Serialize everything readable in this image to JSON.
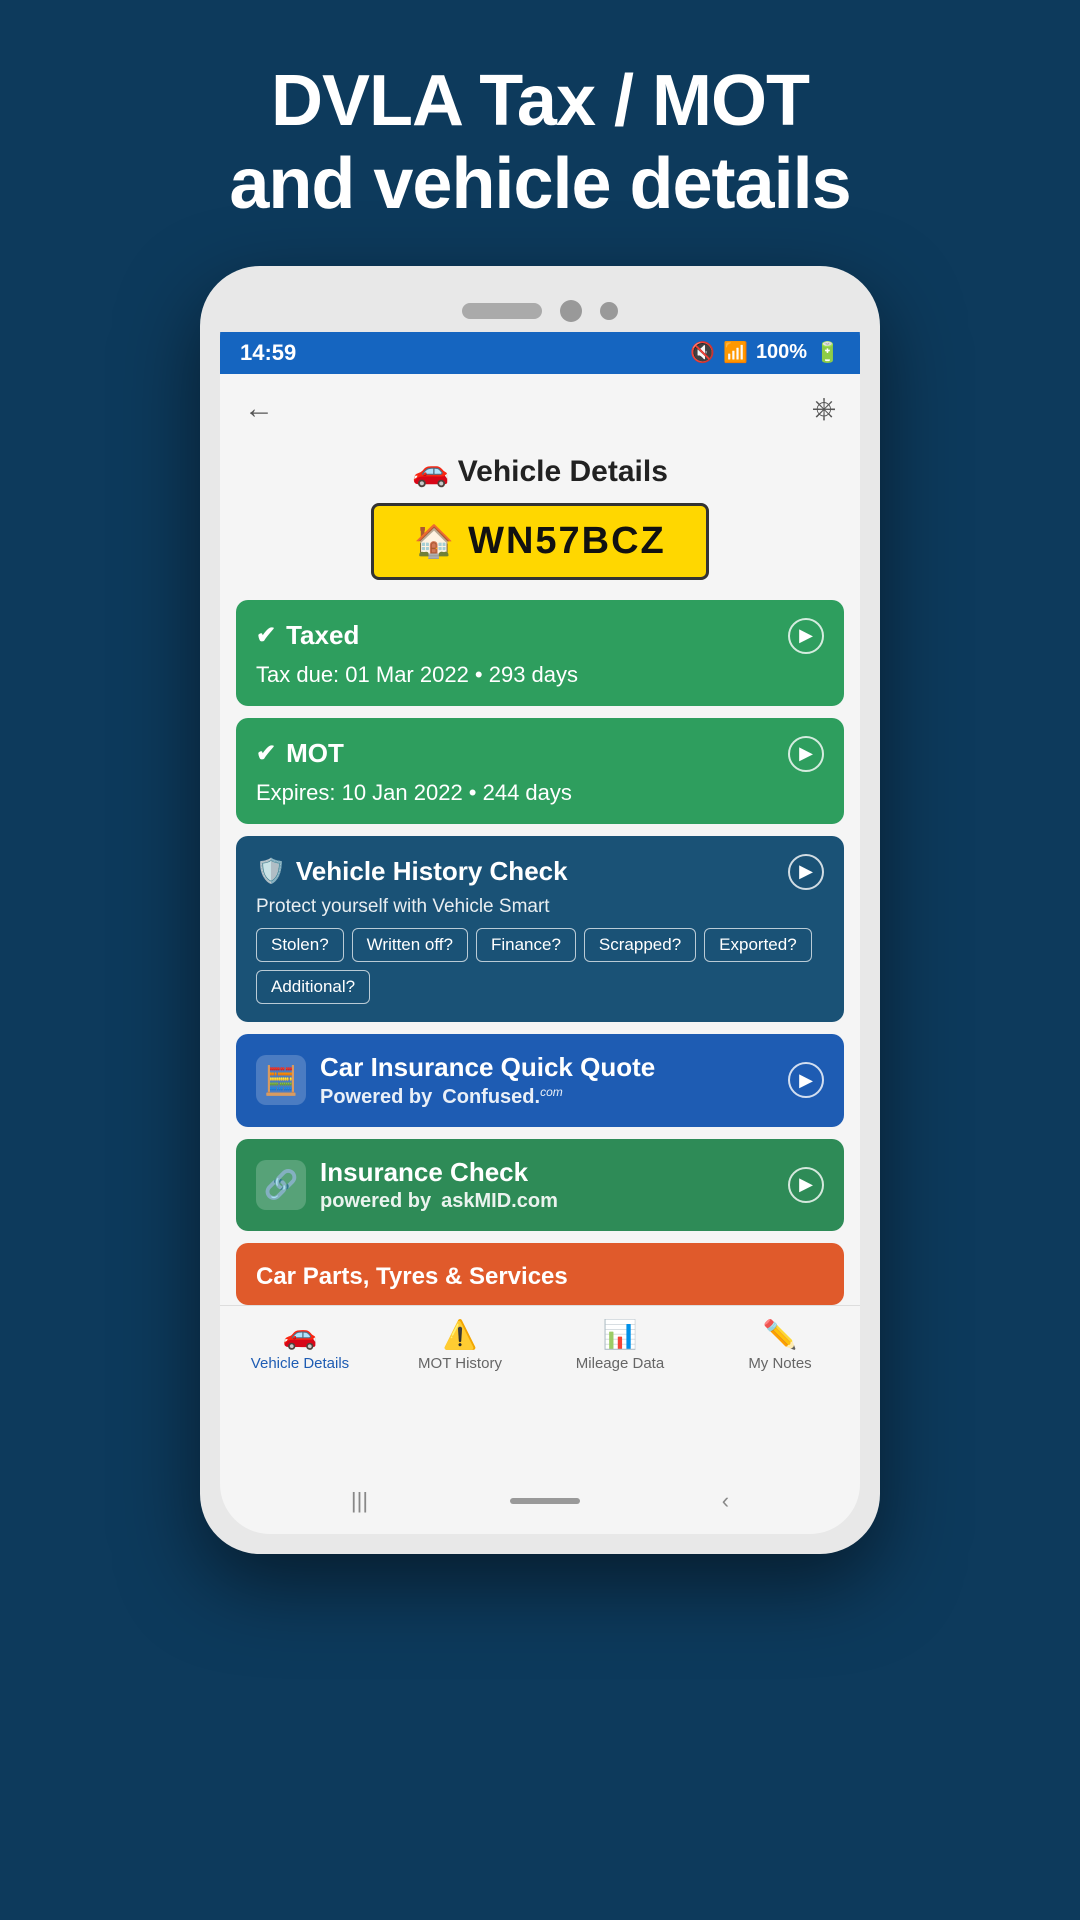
{
  "page": {
    "header_line1": "DVLA Tax / MOT",
    "header_line2": "and vehicle details"
  },
  "status_bar": {
    "time": "14:59",
    "battery": "100%"
  },
  "app": {
    "title": "🚗 Vehicle Details",
    "plate": "WN57BCZ",
    "plate_icon": "🏠"
  },
  "cards": {
    "taxed": {
      "label": "Taxed",
      "detail": "Tax due: 01 Mar 2022 • 293 days"
    },
    "mot": {
      "label": "MOT",
      "detail": "Expires: 10 Jan 2022 • 244 days"
    },
    "history": {
      "title": "Vehicle History Check",
      "subtitle": "Protect yourself with Vehicle Smart",
      "tags": [
        "Stolen?",
        "Written off?",
        "Finance?",
        "Scrapped?",
        "Exported?",
        "Additional?"
      ]
    },
    "insurance_quote": {
      "title": "Car Insurance Quick Quote",
      "powered_by": "Powered by",
      "brand": "Confused."
    },
    "insurance_check": {
      "title": "Insurance Check",
      "powered_by": "powered by",
      "brand": "askMID.com"
    },
    "parts": {
      "title": "Car Parts, Tyres & Services"
    }
  },
  "bottom_nav": {
    "items": [
      {
        "label": "Vehicle Details",
        "active": true
      },
      {
        "label": "MOT History",
        "active": false
      },
      {
        "label": "Mileage Data",
        "active": false
      },
      {
        "label": "My Notes",
        "active": false
      }
    ]
  }
}
